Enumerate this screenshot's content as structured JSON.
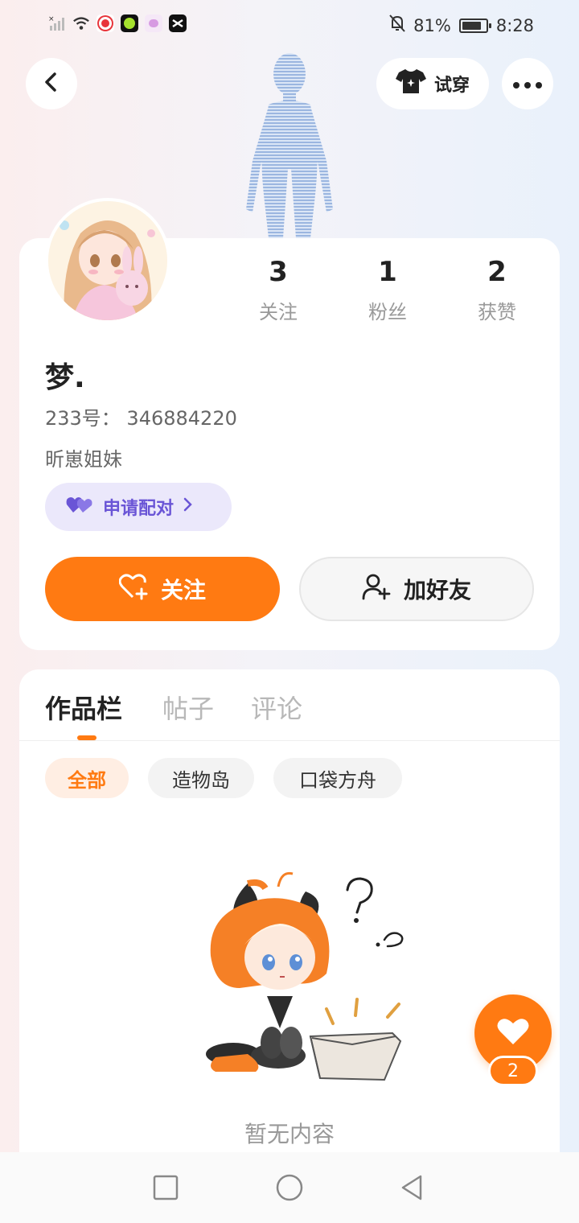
{
  "status_bar": {
    "battery_percent": "81%",
    "time": "8:28",
    "battery_level": 0.81,
    "icons": [
      "signal-off-icon",
      "wifi-icon",
      "app-red-icon",
      "app-green-icon",
      "app-pink-icon",
      "capcut-icon",
      "mute-bell-icon",
      "battery-icon"
    ]
  },
  "header": {
    "tryon_label": "试穿"
  },
  "profile": {
    "stats": [
      {
        "num": "3",
        "label": "关注"
      },
      {
        "num": "1",
        "label": "粉丝"
      },
      {
        "num": "2",
        "label": "获赞"
      }
    ],
    "username": "梦.",
    "user_id": "233号： 346884220",
    "bio": "昕崽姐妹",
    "pair_label": "申请配对",
    "follow_label": "关注",
    "add_friend_label": "加好友"
  },
  "content": {
    "tabs": [
      "作品栏",
      "帖子",
      "评论"
    ],
    "active_tab": 0,
    "filters": [
      "全部",
      "造物岛",
      "口袋方舟"
    ],
    "active_filter": 0,
    "empty_text": "暂无内容"
  },
  "like_fab": {
    "count": "2"
  },
  "colors": {
    "accent": "#ff7a12",
    "pair_purple": "#6a55d6",
    "pair_bg": "#ebe8fb"
  }
}
